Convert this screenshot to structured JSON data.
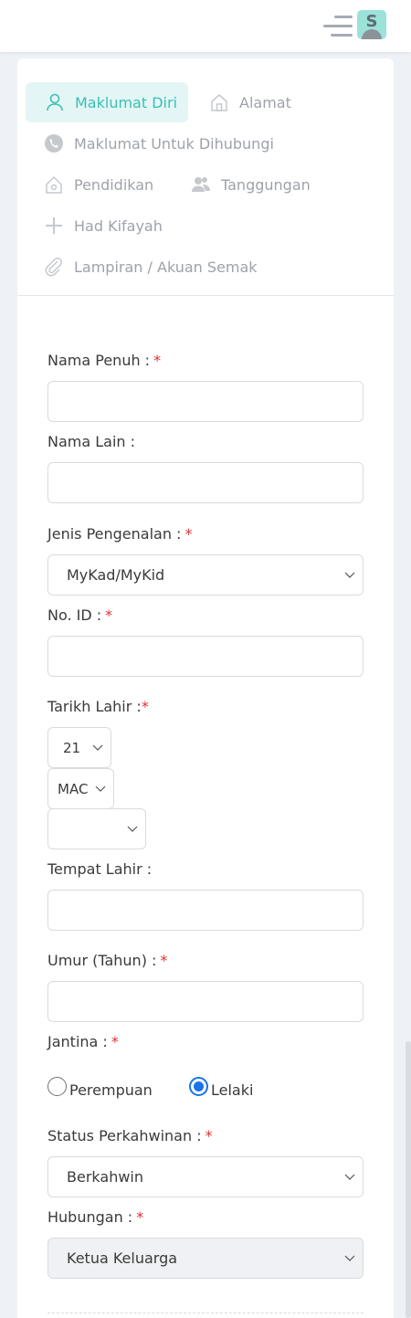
{
  "header": {
    "menu_icon": "hamburger-icon",
    "avatar_letter": "S"
  },
  "tabs": [
    {
      "label": "Maklumat Diri",
      "icon": "user-icon",
      "active": true
    },
    {
      "label": "Alamat",
      "icon": "home-icon",
      "active": false
    },
    {
      "label": "Maklumat Untuk Dihubungi",
      "icon": "phone-icon",
      "active": false
    },
    {
      "label": "Pendidikan",
      "icon": "education-icon",
      "active": false
    },
    {
      "label": "Tanggungan",
      "icon": "dependents-icon",
      "active": false
    },
    {
      "label": "Had Kifayah",
      "icon": "plus-icon",
      "active": false
    },
    {
      "label": "Lampiran / Akuan Semak",
      "icon": "paperclip-icon",
      "active": false
    }
  ],
  "form": {
    "nama_penuh": {
      "label": "Nama Penuh :",
      "required": "*",
      "value": ""
    },
    "nama_lain": {
      "label": "Nama Lain :",
      "value": ""
    },
    "jenis_pengenalan": {
      "label": "Jenis Pengenalan :",
      "required": "*",
      "value": "MyKad/MyKid"
    },
    "no_id": {
      "label": "No. ID :",
      "required": "*",
      "value": ""
    },
    "tarikh_lahir": {
      "label": "Tarikh Lahir :",
      "required": "*",
      "day": "21",
      "month": "MAC",
      "year": ""
    },
    "tempat_lahir": {
      "label": "Tempat Lahir :",
      "value": ""
    },
    "umur": {
      "label": "Umur (Tahun) :",
      "required": "*",
      "value": ""
    },
    "jantina": {
      "label": "Jantina :",
      "required": "*",
      "options": [
        "Perempuan",
        "Lelaki"
      ],
      "selected": "Lelaki"
    },
    "status_perkahwinan": {
      "label": "Status Perkahwinan :",
      "required": "*",
      "value": "Berkahwin"
    },
    "hubungan": {
      "label": "Hubungan :",
      "required": "*",
      "value": "Ketua Keluarga"
    }
  },
  "colors": {
    "accent": "#3bbfb3",
    "required": "#e0302f",
    "radio_checked": "#1a73e8"
  }
}
